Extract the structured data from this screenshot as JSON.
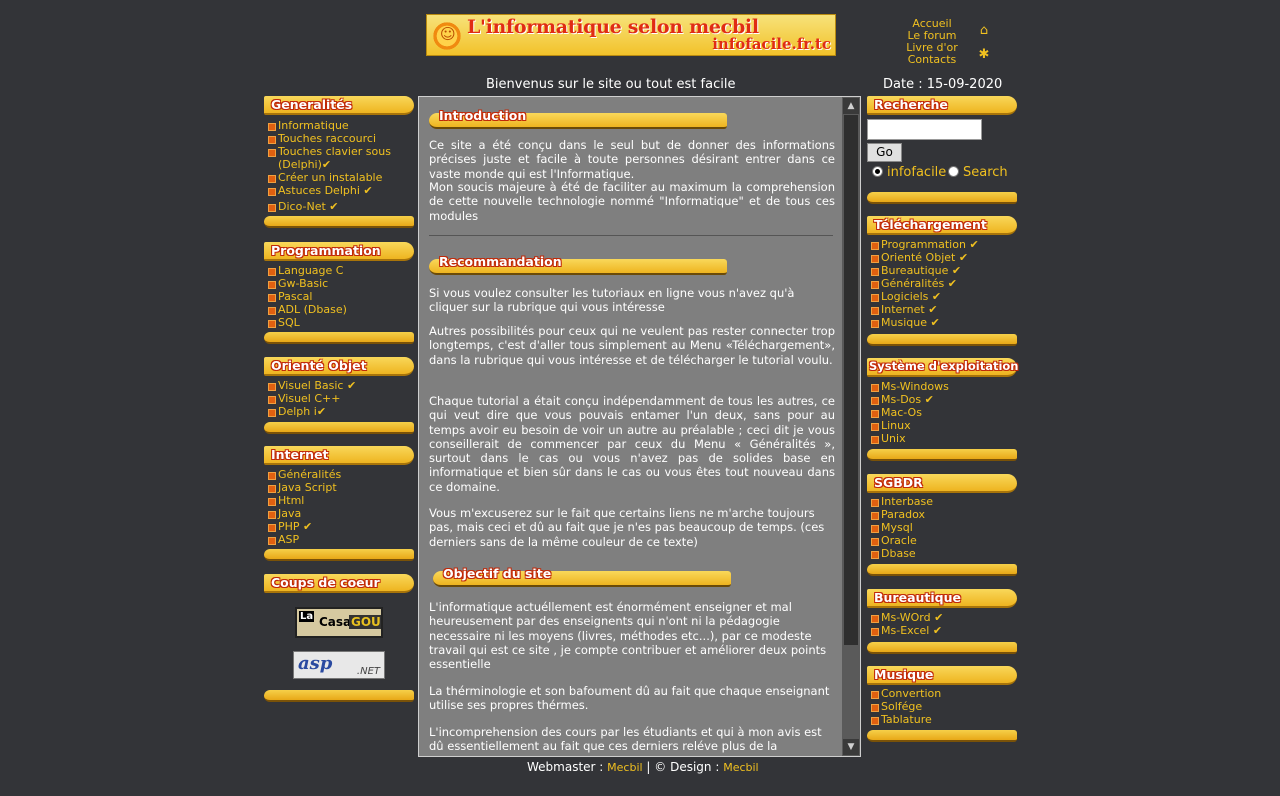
{
  "banner": {
    "title": "L'informatique selon mecbil",
    "site": "infofacile.fr.tc"
  },
  "topnav": {
    "items": [
      "Accueil",
      "Le forum",
      "Livre d'or",
      "Contacts"
    ],
    "icons": [
      "home-icon",
      "bookmark-icon"
    ]
  },
  "welcome": "Bienvenus sur le site ou tout est facile",
  "date": "Date :  15-09-2020",
  "left": {
    "generalites": {
      "title": "Generalités",
      "items": [
        "Informatique",
        "Touches raccourci",
        "Touches clavier sous",
        "(Delphi)",
        "Créer un instalable",
        "Astuces Delphi",
        "Dico-Net"
      ]
    },
    "programmation": {
      "title": "Programmation",
      "items": [
        "Language C",
        "Gw-Basic",
        "Pascal",
        "ADL (Dbase)",
        "SQL"
      ]
    },
    "oriente_objet": {
      "title": "Orienté Objet",
      "items": [
        "Visuel Basic",
        "Visuel C++",
        "Delph i"
      ]
    },
    "internet": {
      "title": "Internet",
      "items": [
        "Généralités",
        "Java Script",
        "Html",
        "Java",
        "PHP",
        "ASP"
      ]
    },
    "coups_de_coeur": {
      "title": "Coups de coeur",
      "logo1": [
        "La",
        "Casa",
        "GOUM"
      ],
      "logo2": [
        "asp",
        ".NET"
      ]
    }
  },
  "right": {
    "recherche": {
      "title": "Recherche",
      "input_value": "",
      "go": "Go",
      "radio1": "infofacile",
      "radio2": "Search"
    },
    "telechargement": {
      "title": "Téléchargement",
      "items": [
        "Programmation",
        "Orienté Objet",
        "Bureautique",
        "Généralités",
        "Logiciels",
        "Internet",
        "Musique"
      ]
    },
    "systeme": {
      "title": "Système d'exploitation",
      "items": [
        "Ms-Windows",
        "Ms-Dos",
        "Mac-Os",
        "Linux",
        "Unix"
      ]
    },
    "sgbdr": {
      "title": "SGBDR",
      "items": [
        "Interbase",
        "Paradox",
        "Mysql",
        "Oracle",
        "Dbase"
      ]
    },
    "bureautique": {
      "title": "Bureautique",
      "items": [
        "Ms-WOrd",
        "Ms-Excel"
      ]
    },
    "musique": {
      "title": "Musique",
      "items": [
        "Convertion",
        "Solfége",
        "Tablature"
      ]
    }
  },
  "content": {
    "intro_title": "Introduction",
    "intro_p1": "Ce site a été conçu dans le seul but de donner des informations précises juste et facile à toute personnes désirant entrer dans ce vaste monde qui est l'Informatique.",
    "intro_p2": "Mon soucis majeure à été de faciliter au maximum la comprehension de cette nouvelle technologie nommé \"Informatique\" et de tous ces modules",
    "reco_title": "Recommandation",
    "reco_p1": "Si vous voulez consulter les tutoriaux en ligne vous n'avez qu'à cliquer sur la rubrique qui vous intéresse",
    "reco_p2": "Autres possibilités pour ceux qui ne veulent pas rester connecter trop longtemps, c'est d'aller tous simplement au Menu «Téléchargement», dans la rubrique qui vous intéresse et de télécharger le tutorial voulu.",
    "reco_p3": "Chaque tutorial a était conçu indépendamment de tous les autres, ce qui veut dire que vous pouvais entamer l'un deux, sans pour au temps avoir eu besoin de voir un autre au préalable ; ceci dit je vous conseillerait de commencer par ceux du Menu « Généralités », surtout dans le cas ou vous n'avez pas de solides base en informatique et bien sûr dans le cas ou vous êtes tout nouveau dans ce domaine.",
    "reco_p4": "Vous m'excuserez sur le fait que certains liens ne m'arche toujours pas, mais ceci et dû au fait que je n'es pas beaucoup de temps. (ces derniers sans de la même couleur de ce texte)",
    "obj_title": "Objectif du site",
    "obj_p1": "L'informatique actuéllement est énormément enseigner et mal heureusement par des enseignents qui n'ont ni la pédagogie necessaire ni les moyens (livres, méthodes etc...), par ce modeste travail qui est ce site , je compte contribuer et améliorer deux points essentielle",
    "obj_p2": "La thérminologie et son bafoument dû au fait que chaque enseignant utilise ses propres thérmes.",
    "obj_p3": "L'incomprehension des cours par les étudiants et qui à mon avis est dû essentiellement au fait que ces derniers reléve plus de la"
  },
  "footer": {
    "webmaster_label": "Webmaster :",
    "webmaster": "Mecbil",
    "design_label": "| © Design :",
    "designer": "Mecbil"
  },
  "check": "✔"
}
